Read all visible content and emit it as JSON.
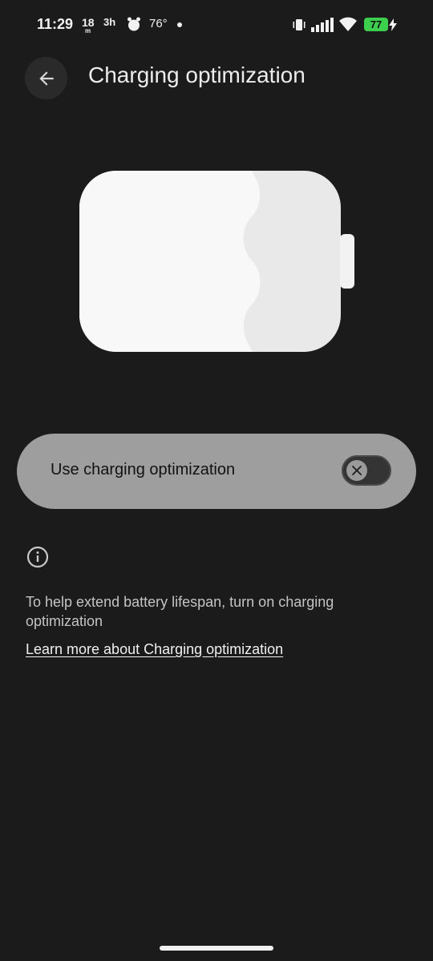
{
  "status_bar": {
    "time": "11:29",
    "notif_num": "18",
    "notif_small": "m",
    "notif_hours": "3h",
    "temperature": "76°",
    "battery_level": "77",
    "battery_color": "#3ccf4e"
  },
  "header": {
    "title": "Charging optimization",
    "back_icon": "arrow-back-icon"
  },
  "illustration": {
    "icon": "battery-illustration"
  },
  "toggle": {
    "label": "Use charging optimization",
    "state": "off",
    "icon": "close-icon"
  },
  "info": {
    "icon": "info-icon",
    "text": "To help extend battery lifespan, turn on charging optimization",
    "link": "Learn more about Charging optimization"
  },
  "colors": {
    "background": "#1b1b1b",
    "card": "#9e9e9e",
    "switch_track": "#343434"
  }
}
